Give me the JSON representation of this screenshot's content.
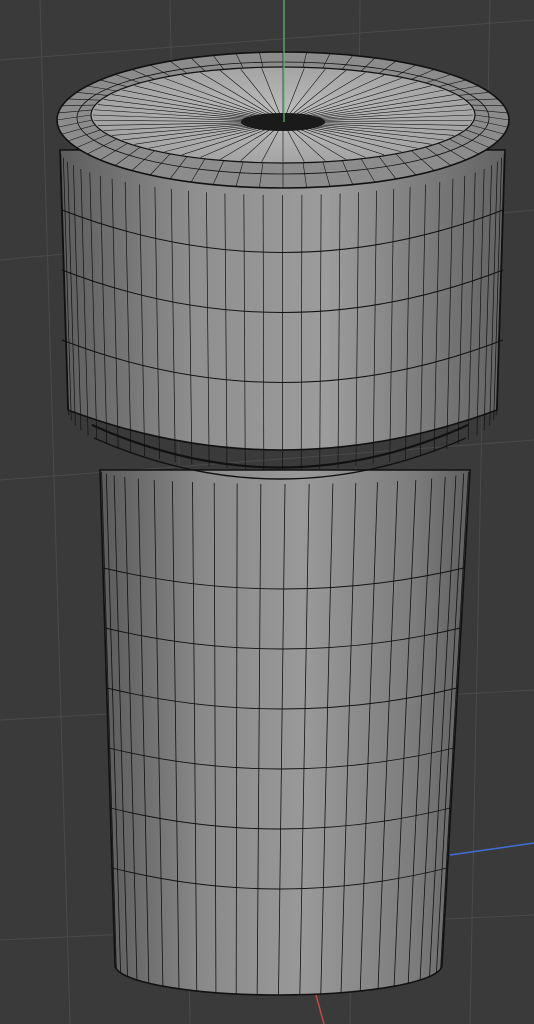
{
  "viewport": {
    "background": "#3a3a3a",
    "grid_color": "#4a4a4a",
    "axes": {
      "y_color": "#5fbf6a",
      "x_color": "#c04a4a",
      "z_color": "#3f6fd6"
    }
  },
  "object": {
    "name": "",
    "type": "cylinder-with-cap",
    "shading": "gray-solid-wireframe",
    "face_color": "#8e8e8e",
    "edge_color": "#111111"
  }
}
